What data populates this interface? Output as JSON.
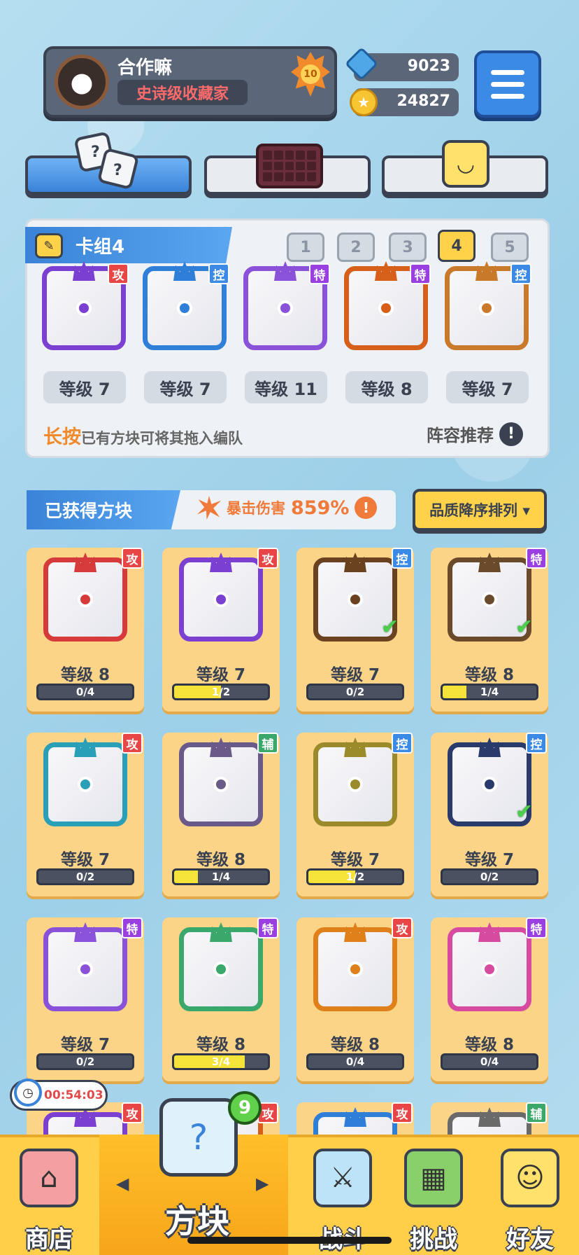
{
  "player": {
    "name": "合作嘛",
    "title": "史诗级收藏家",
    "rank": "10"
  },
  "currency": {
    "gems": "9023",
    "coins": "24827"
  },
  "deck": {
    "title": "卡组4",
    "numbers": [
      "1",
      "2",
      "3",
      "4",
      "5"
    ],
    "selected_index": 3,
    "cards": [
      {
        "tag": "攻",
        "tag_color": "#e84646",
        "color": "#7b3fd1",
        "level": "等级 7"
      },
      {
        "tag": "控",
        "tag_color": "#3a8ae6",
        "color": "#2f7ed8",
        "level": "等级 7"
      },
      {
        "tag": "特",
        "tag_color": "#9a3fe0",
        "color": "#8a52d8",
        "level": "等级 11"
      },
      {
        "tag": "特",
        "tag_color": "#9a3fe0",
        "color": "#d6601a",
        "level": "等级 8"
      },
      {
        "tag": "控",
        "tag_color": "#3a8ae6",
        "color": "#c9792a",
        "level": "等级 7"
      }
    ],
    "hint_strong": "长按",
    "hint_rest": "已有方块可将其拖入编队",
    "recommend": "阵容推荐"
  },
  "owned": {
    "tab_label": "已获得方块",
    "crit_label": "暴击伤害",
    "crit_value": "859%",
    "sort_label": "品质降序排列 ▾"
  },
  "cards": [
    {
      "tag": "攻",
      "tag_color": "#e84646",
      "color": "#d63a3a",
      "level": "等级 8",
      "progress": "0/4",
      "fill": 0,
      "check": false
    },
    {
      "tag": "攻",
      "tag_color": "#e84646",
      "color": "#7b3fd1",
      "level": "等级 7",
      "progress": "1/2",
      "fill": 0.5,
      "check": false
    },
    {
      "tag": "控",
      "tag_color": "#3a8ae6",
      "color": "#6a4220",
      "level": "等级 7",
      "progress": "0/2",
      "fill": 0,
      "check": true
    },
    {
      "tag": "特",
      "tag_color": "#9a3fe0",
      "color": "#6a4a2a",
      "level": "等级 8",
      "progress": "1/4",
      "fill": 0.25,
      "check": true
    },
    {
      "tag": "攻",
      "tag_color": "#e84646",
      "color": "#2aa0b8",
      "level": "等级 7",
      "progress": "0/2",
      "fill": 0,
      "check": false
    },
    {
      "tag": "辅",
      "tag_color": "#3aa86a",
      "color": "#6a5a8a",
      "level": "等级 8",
      "progress": "1/4",
      "fill": 0.25,
      "check": false
    },
    {
      "tag": "控",
      "tag_color": "#3a8ae6",
      "color": "#9a8a2a",
      "level": "等级 7",
      "progress": "1/2",
      "fill": 0.5,
      "check": false
    },
    {
      "tag": "控",
      "tag_color": "#3a8ae6",
      "color": "#2a3a6a",
      "level": "等级 7",
      "progress": "0/2",
      "fill": 0,
      "check": true
    },
    {
      "tag": "特",
      "tag_color": "#9a3fe0",
      "color": "#8a52d8",
      "level": "等级 7",
      "progress": "0/2",
      "fill": 0,
      "check": false
    },
    {
      "tag": "特",
      "tag_color": "#9a3fe0",
      "color": "#3aa86a",
      "level": "等级 8",
      "progress": "3/4",
      "fill": 0.75,
      "check": false
    },
    {
      "tag": "攻",
      "tag_color": "#e84646",
      "color": "#e0801a",
      "level": "等级 8",
      "progress": "0/4",
      "fill": 0,
      "check": false
    },
    {
      "tag": "特",
      "tag_color": "#9a3fe0",
      "color": "#d64aa0",
      "level": "等级 8",
      "progress": "0/4",
      "fill": 0,
      "check": false
    },
    {
      "tag": "攻",
      "tag_color": "#e84646",
      "color": "#7b3fd1",
      "level": "",
      "progress": "",
      "fill": 0,
      "check": false
    },
    {
      "tag": "攻",
      "tag_color": "#e84646",
      "color": "#d6601a",
      "level": "",
      "progress": "",
      "fill": 0,
      "check": false
    },
    {
      "tag": "攻",
      "tag_color": "#e84646",
      "color": "#2f7ed8",
      "level": "",
      "progress": "",
      "fill": 0,
      "check": false
    },
    {
      "tag": "辅",
      "tag_color": "#3aa86a",
      "color": "#6a6a6a",
      "level": "",
      "progress": "",
      "fill": 0,
      "check": false
    }
  ],
  "timer": "00:54:03",
  "nav": {
    "shop": "商店",
    "blocks": "方块",
    "blocks_badge": "9",
    "battle": "战斗",
    "challenge": "挑战",
    "friends": "好友"
  }
}
